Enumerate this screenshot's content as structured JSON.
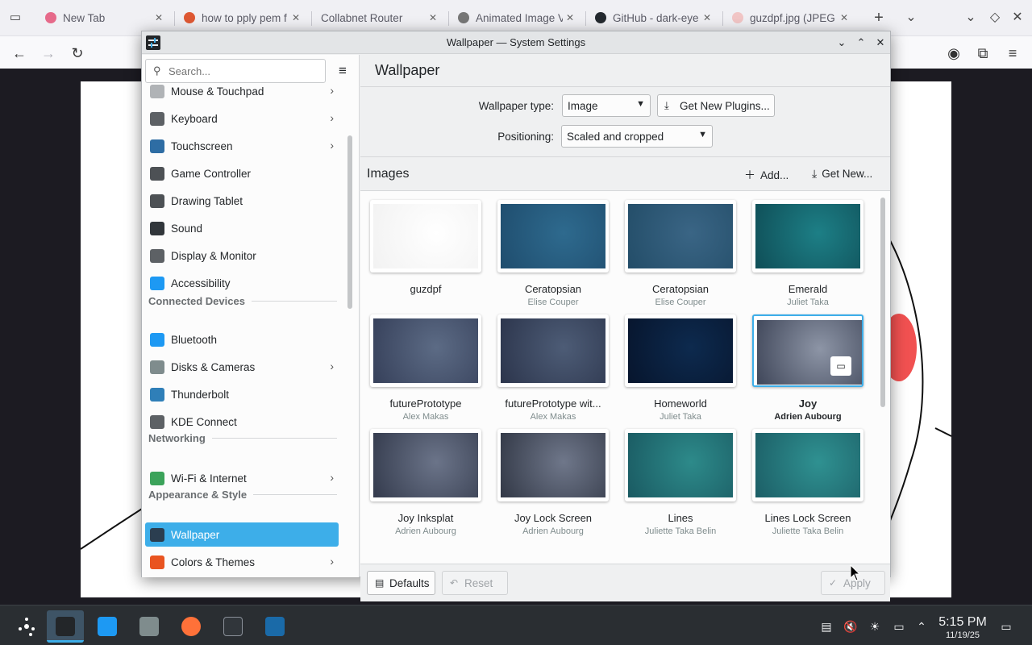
{
  "browser": {
    "tabs": [
      {
        "title": "New Tab",
        "icon": "firefox-icon"
      },
      {
        "title": "how to pply pem f",
        "icon": "duckduckgo-icon"
      },
      {
        "title": "Collabnet Router",
        "icon": ""
      },
      {
        "title": "Animated Image V",
        "icon": "gear-favicon"
      },
      {
        "title": "GitHub - dark-eye",
        "icon": "github-icon"
      },
      {
        "title": "guzdpf.jpg (JPEG I",
        "icon": "image-favicon"
      }
    ]
  },
  "window": {
    "title": "Wallpaper — System Settings"
  },
  "sidebar": {
    "search_placeholder": "Search...",
    "items": [
      {
        "label": "Mouse & Touchpad",
        "chevron": true,
        "color": "#b0b3b6"
      },
      {
        "label": "Keyboard",
        "chevron": true,
        "color": "#5d6165"
      },
      {
        "label": "Touchscreen",
        "chevron": true,
        "color": "#2e6da4"
      },
      {
        "label": "Game Controller",
        "chevron": false,
        "color": "#4d5155"
      },
      {
        "label": "Drawing Tablet",
        "chevron": false,
        "color": "#4d5155"
      },
      {
        "label": "Sound",
        "chevron": false,
        "color": "#31363b"
      },
      {
        "label": "Display & Monitor",
        "chevron": false,
        "color": "#5d6165"
      },
      {
        "label": "Accessibility",
        "chevron": false,
        "color": "#1d99f3"
      },
      {
        "label": "Bluetooth",
        "chevron": false,
        "color": "#1d99f3"
      },
      {
        "label": "Disks & Cameras",
        "chevron": true,
        "color": "#7f8c8d"
      },
      {
        "label": "Thunderbolt",
        "chevron": false,
        "color": "#2f7fb8"
      },
      {
        "label": "KDE Connect",
        "chevron": false,
        "color": "#5d6165"
      },
      {
        "label": "Wi-Fi & Internet",
        "chevron": true,
        "color": "#3ba35a"
      },
      {
        "label": "Wallpaper",
        "chevron": false,
        "color": "#2b3e50"
      },
      {
        "label": "Colors & Themes",
        "chevron": true,
        "color": "#e95420"
      }
    ],
    "categories": [
      "Connected Devices",
      "Networking",
      "Appearance & Style"
    ]
  },
  "main": {
    "title": "Wallpaper",
    "wallpaper_type_label": "Wallpaper type:",
    "wallpaper_type_value": "Image",
    "get_plugins_label": "Get New Plugins...",
    "positioning_label": "Positioning:",
    "positioning_value": "Scaled and cropped",
    "images_title": "Images",
    "add_label": "Add...",
    "get_new_label": "Get New...",
    "wallpapers": [
      {
        "name": "guzdpf",
        "author": "",
        "colors": [
          "#ffffff",
          "#f2f2f2"
        ]
      },
      {
        "name": "Ceratopsian",
        "author": "Elise Couper",
        "colors": [
          "#2e6a8e",
          "#1f4d6e"
        ]
      },
      {
        "name": "Ceratopsian",
        "author": "Elise Couper",
        "colors": [
          "#3a6585",
          "#234d68"
        ]
      },
      {
        "name": "Emerald",
        "author": "Juliet Taka",
        "colors": [
          "#1d7f86",
          "#0f4e57"
        ]
      },
      {
        "name": "futurePrototype",
        "author": "Alex Makas",
        "colors": [
          "#5c6b85",
          "#36405a"
        ]
      },
      {
        "name": "futurePrototype wit...",
        "author": "Alex Makas",
        "colors": [
          "#4d5c76",
          "#2c354c"
        ]
      },
      {
        "name": "Homeworld",
        "author": "Juliet Taka",
        "colors": [
          "#0d2a4e",
          "#07152d"
        ]
      },
      {
        "name": "Joy",
        "author": "Adrien Aubourg",
        "colors": [
          "#8d95a6",
          "#3f4659"
        ]
      },
      {
        "name": "Joy Inksplat",
        "author": "Adrien Aubourg",
        "colors": [
          "#6b7489",
          "#343b4d"
        ]
      },
      {
        "name": "Joy Lock Screen",
        "author": "Adrien Aubourg",
        "colors": [
          "#6f778a",
          "#323846"
        ]
      },
      {
        "name": "Lines",
        "author": "Juliette Taka Belin",
        "colors": [
          "#2d8a8a",
          "#1a5a62"
        ]
      },
      {
        "name": "Lines Lock Screen",
        "author": "Juliette Taka Belin",
        "colors": [
          "#2f9191",
          "#1c5e66"
        ]
      }
    ],
    "selected_wallpaper": "Joy",
    "defaults_label": "Defaults",
    "reset_label": "Reset",
    "apply_label": "Apply"
  },
  "taskbar": {
    "time": "5:15 PM",
    "date": "11/19/25"
  },
  "colors": {
    "accent": "#3daee9",
    "taskbar": "#2a2e32"
  }
}
